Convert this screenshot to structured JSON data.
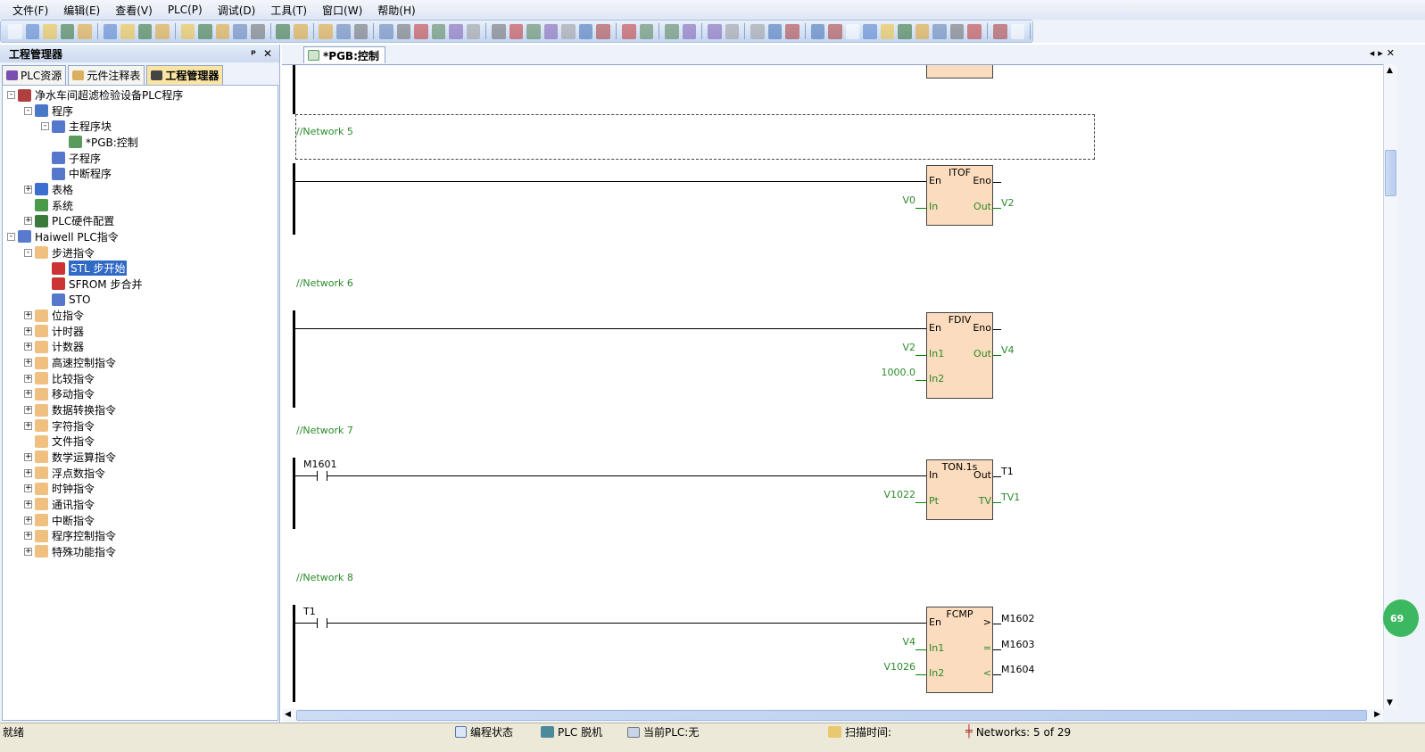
{
  "menu": [
    "文件(F)",
    "编辑(E)",
    "查看(V)",
    "PLC(P)",
    "调试(D)",
    "工具(T)",
    "窗口(W)",
    "帮助(H)"
  ],
  "left_panel": {
    "title": "工程管理器",
    "pin": "ᵖ",
    "close": "✕",
    "tabs": [
      "PLC资源",
      "元件注释表",
      "工程管理器"
    ],
    "tree": [
      {
        "label": "净水车间超滤检验设备PLC程序",
        "level": 0,
        "exp": "-",
        "icon": "project-icon",
        "color": "#b04040"
      },
      {
        "label": "程序",
        "level": 1,
        "exp": "-",
        "icon": "program-icon",
        "color": "#4a78c8"
      },
      {
        "label": "主程序块",
        "level": 2,
        "exp": "-",
        "icon": "block-icon",
        "color": "#5577cc"
      },
      {
        "label": "*PGB:控制",
        "level": 3,
        "exp": "",
        "icon": "ladder-icon",
        "color": "#5a9a5a"
      },
      {
        "label": "子程序",
        "level": 2,
        "exp": "",
        "icon": "block-icon",
        "color": "#5577cc"
      },
      {
        "label": "中断程序",
        "level": 2,
        "exp": "",
        "icon": "block-icon",
        "color": "#5577cc"
      },
      {
        "label": "表格",
        "level": 1,
        "exp": "+",
        "icon": "table-icon",
        "color": "#3a6fd0"
      },
      {
        "label": "系统",
        "level": 1,
        "exp": "",
        "icon": "system-icon",
        "color": "#4a9a4a"
      },
      {
        "label": "PLC硬件配置",
        "level": 1,
        "exp": "+",
        "icon": "hardware-icon",
        "color": "#3a7a3a"
      },
      {
        "label": "Haiwell PLC指令",
        "level": 0,
        "exp": "-",
        "icon": "instructions-icon",
        "color": "#5a7ad0"
      },
      {
        "label": "步进指令",
        "level": 1,
        "exp": "-",
        "icon": "folder-icon",
        "color": "#f0c080"
      },
      {
        "label": "STL 步开始",
        "level": 2,
        "exp": "",
        "icon": "stl-icon",
        "color": "#cc3333",
        "selected": true
      },
      {
        "label": "SFROM 步合并",
        "level": 2,
        "exp": "",
        "icon": "sfrom-icon",
        "color": "#cc3333"
      },
      {
        "label": "STO",
        "level": 2,
        "exp": "",
        "icon": "sto-icon",
        "color": "#5577cc"
      },
      {
        "label": "位指令",
        "level": 1,
        "exp": "+",
        "icon": "folder-icon",
        "color": "#f0c080"
      },
      {
        "label": "计时器",
        "level": 1,
        "exp": "+",
        "icon": "folder-icon",
        "color": "#f0c080"
      },
      {
        "label": "计数器",
        "level": 1,
        "exp": "+",
        "icon": "folder-icon",
        "color": "#f0c080"
      },
      {
        "label": "高速控制指令",
        "level": 1,
        "exp": "+",
        "icon": "folder-icon",
        "color": "#f0c080"
      },
      {
        "label": "比较指令",
        "level": 1,
        "exp": "+",
        "icon": "folder-icon",
        "color": "#f0c080"
      },
      {
        "label": "移动指令",
        "level": 1,
        "exp": "+",
        "icon": "folder-icon",
        "color": "#f0c080"
      },
      {
        "label": "数据转换指令",
        "level": 1,
        "exp": "+",
        "icon": "folder-icon",
        "color": "#f0c080"
      },
      {
        "label": "字符指令",
        "level": 1,
        "exp": "+",
        "icon": "folder-icon",
        "color": "#f0c080"
      },
      {
        "label": "文件指令",
        "level": 1,
        "exp": "",
        "icon": "folder-icon",
        "color": "#f0c080"
      },
      {
        "label": "数学运算指令",
        "level": 1,
        "exp": "+",
        "icon": "folder-icon",
        "color": "#f0c080"
      },
      {
        "label": "浮点数指令",
        "level": 1,
        "exp": "+",
        "icon": "folder-icon",
        "color": "#f0c080"
      },
      {
        "label": "时钟指令",
        "level": 1,
        "exp": "+",
        "icon": "folder-icon",
        "color": "#f0c080"
      },
      {
        "label": "通讯指令",
        "level": 1,
        "exp": "+",
        "icon": "folder-icon",
        "color": "#f0c080"
      },
      {
        "label": "中断指令",
        "level": 1,
        "exp": "+",
        "icon": "folder-icon",
        "color": "#f0c080"
      },
      {
        "label": "程序控制指令",
        "level": 1,
        "exp": "+",
        "icon": "folder-icon",
        "color": "#f0c080"
      },
      {
        "label": "特殊功能指令",
        "level": 1,
        "exp": "+",
        "icon": "folder-icon",
        "color": "#f0c080"
      }
    ]
  },
  "editor": {
    "tab": "*PGB:控制"
  },
  "networks": [
    {
      "comment": "//Network 5",
      "block": "ITOF",
      "contact": "",
      "in": [
        [
          "En",
          ""
        ],
        [
          "In",
          "V0"
        ]
      ],
      "out": [
        [
          "Eno",
          ""
        ],
        [
          "Out",
          "V2"
        ]
      ]
    },
    {
      "comment": "//Network 6",
      "block": "FDIV",
      "contact": "",
      "in": [
        [
          "En",
          ""
        ],
        [
          "In1",
          "V2"
        ],
        [
          "In2",
          "1000.0"
        ]
      ],
      "out": [
        [
          "Eno",
          ""
        ],
        [
          "Out",
          "V4"
        ]
      ]
    },
    {
      "comment": "//Network 7",
      "block": "TON.1s",
      "contact": "M1601",
      "in": [
        [
          "In",
          ""
        ],
        [
          "Pt",
          "V1022"
        ]
      ],
      "out": [
        [
          "Out",
          "T1"
        ],
        [
          "TV",
          "TV1"
        ]
      ]
    },
    {
      "comment": "//Network 8",
      "block": "FCMP",
      "contact": "T1",
      "in": [
        [
          "En",
          ""
        ],
        [
          "In1",
          "V4"
        ],
        [
          "In2",
          "V1026"
        ]
      ],
      "out": [
        [
          ">",
          "M1602"
        ],
        [
          "=",
          "M1603"
        ],
        [
          "<",
          "M1604"
        ]
      ]
    }
  ],
  "status": {
    "ready": "就绪",
    "mode": "编程状态",
    "plc": "PLC 脱机",
    "current": "当前PLC:无",
    "scan": "扫描时间:",
    "networks": "Networks:  5 of 29"
  },
  "floating_badge": "69",
  "colors": {
    "block_fill": "#fbdcbe",
    "wire_green": "#2a8a2a",
    "selection": "#316ac5"
  }
}
